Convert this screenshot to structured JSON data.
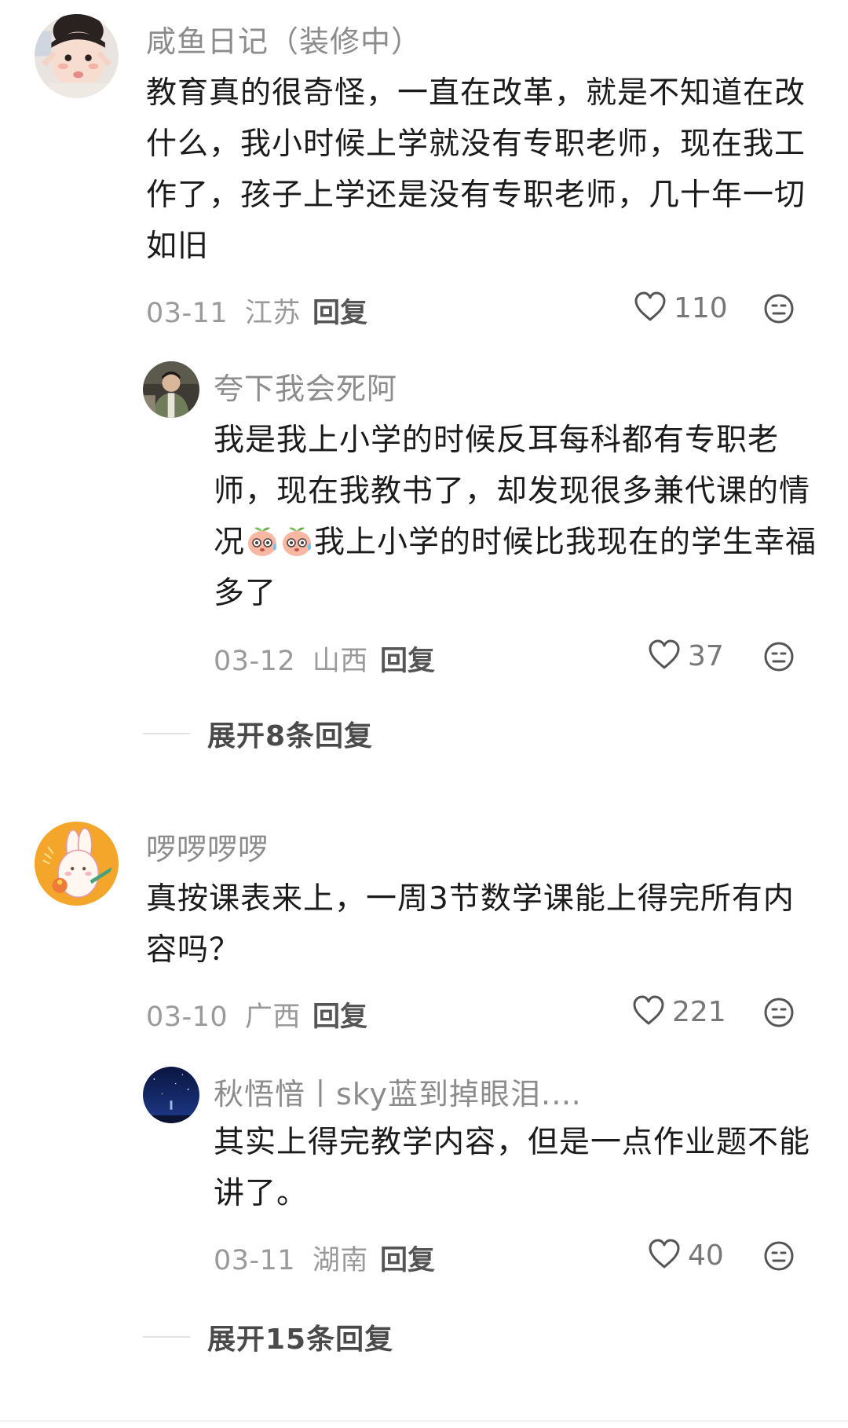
{
  "comments": [
    {
      "username": "咸鱼日记（装修中）",
      "text": "教育真的很奇怪，一直在改革，就是不知道在改什么，我小时候上学就没有专职老师，现在我工作了，孩子上学还是没有专职老师，几十年一切如旧",
      "date": "03-11",
      "location": "江苏",
      "reply_label": "回复",
      "likes": "110",
      "avatar_icon": "toddler-photo-avatar",
      "replies": [
        {
          "username": "夸下我会死阿",
          "text_part1": "我是我上小学的时候反耳每科都有专职老师，现在我教书了，却发现很多兼代课的情况",
          "text_part2": "我上小学的时候比我现在的学生幸福多了",
          "emoji_icon": "sweating-peach-emoji",
          "date": "03-12",
          "location": "山西",
          "reply_label": "回复",
          "likes": "37",
          "avatar_icon": "person-photo-avatar"
        }
      ],
      "expand_label": "展开8条回复"
    },
    {
      "username": "啰啰啰啰",
      "text": "真按课表来上，一周3节数学课能上得完所有内容吗？",
      "date": "03-10",
      "location": "广西",
      "reply_label": "回复",
      "likes": "221",
      "avatar_icon": "bunny-cartoon-avatar",
      "replies": [
        {
          "username": "秋悟愔丨sky蓝到掉眼泪.…",
          "text": "其实上得完教学内容，但是一点作业题不能讲了。",
          "date": "03-11",
          "location": "湖南",
          "reply_label": "回复",
          "likes": "40",
          "avatar_icon": "night-sky-avatar"
        }
      ],
      "expand_label": "展开15条回复"
    }
  ],
  "colors": {
    "username": "#8c8c8c",
    "text": "#1b1b1b",
    "meta": "#9a9a9a",
    "icon": "#555555"
  }
}
